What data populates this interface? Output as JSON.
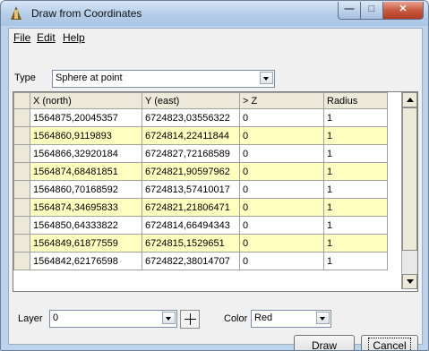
{
  "window": {
    "title": "Draw from Coordinates",
    "min_glyph": "—",
    "max_glyph": "□",
    "close_glyph": "✕"
  },
  "menu": {
    "file": "File",
    "edit": "Edit",
    "help": "Help"
  },
  "type": {
    "label": "Type",
    "value": "Sphere at point"
  },
  "table": {
    "columns": [
      "X (north)",
      "Y (east)",
      "> Z",
      "Radius"
    ],
    "rows": [
      [
        "1564875,20045357",
        "6724823,03556322",
        "0",
        "1"
      ],
      [
        "1564860,9119893",
        "6724814,22411844",
        "0",
        "1"
      ],
      [
        "1564866,32920184",
        "6724827,72168589",
        "0",
        "1"
      ],
      [
        "1564874,68481851",
        "6724821,90597962",
        "0",
        "1"
      ],
      [
        "1564860,70168592",
        "6724813,57410017",
        "0",
        "1"
      ],
      [
        "1564874,34695833",
        "6724821,21806471",
        "0",
        "1"
      ],
      [
        "1564850,64333822",
        "6724814,66494343",
        "0",
        "1"
      ],
      [
        "1564849,61877559",
        "6724815,1529651",
        "0",
        "1"
      ],
      [
        "1564842,62176598",
        "6724822,38014707",
        "0",
        "1"
      ]
    ]
  },
  "layer": {
    "label": "Layer",
    "value": "0"
  },
  "color": {
    "label": "Color",
    "value": "Red"
  },
  "buttons": {
    "draw": "Draw",
    "cancel": "Cancel"
  }
}
